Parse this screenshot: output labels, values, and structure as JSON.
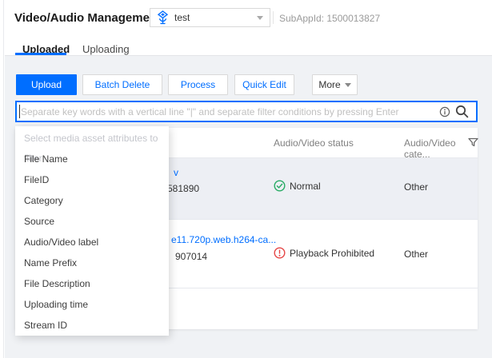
{
  "header": {
    "title": "Video/Audio Management",
    "app_select": {
      "value": "test"
    },
    "subappid": "SubAppId: 1500013827"
  },
  "tabs": [
    {
      "label": "Uploaded",
      "active": true
    },
    {
      "label": "Uploading",
      "active": false
    }
  ],
  "toolbar": {
    "buttons": [
      "Upload",
      "Batch Delete",
      "Process",
      "Quick Edit"
    ],
    "more_label": "More"
  },
  "search": {
    "placeholder": "Separate key words with a vertical line \"|\" and separate filter conditions by pressing Enter",
    "value": ""
  },
  "filter_dropdown": {
    "header": "Select media asset attributes to filter",
    "items": [
      "File Name",
      "FileID",
      "Category",
      "Source",
      "Audio/Video label",
      "Name Prefix",
      "File Description",
      "Uploading time",
      "Stream ID"
    ]
  },
  "table": {
    "columns": [
      "Audio/Video status",
      "Audio/Video cate..."
    ],
    "rows": [
      {
        "name_fragment": "v",
        "id_fragment": "581890",
        "status": "Normal",
        "status_type": "normal",
        "category": "Other"
      },
      {
        "name_fragment": "e11.720p.web.h264-ca...",
        "id_fragment": "907014",
        "status": "Playback Prohibited",
        "status_type": "prohibited",
        "category": "Other"
      }
    ]
  },
  "colors": {
    "accent": "#006eff",
    "success": "#27ab64",
    "error": "#e54545",
    "page_bg": "#f0f2f5",
    "row_highlight": "#edeff4"
  }
}
